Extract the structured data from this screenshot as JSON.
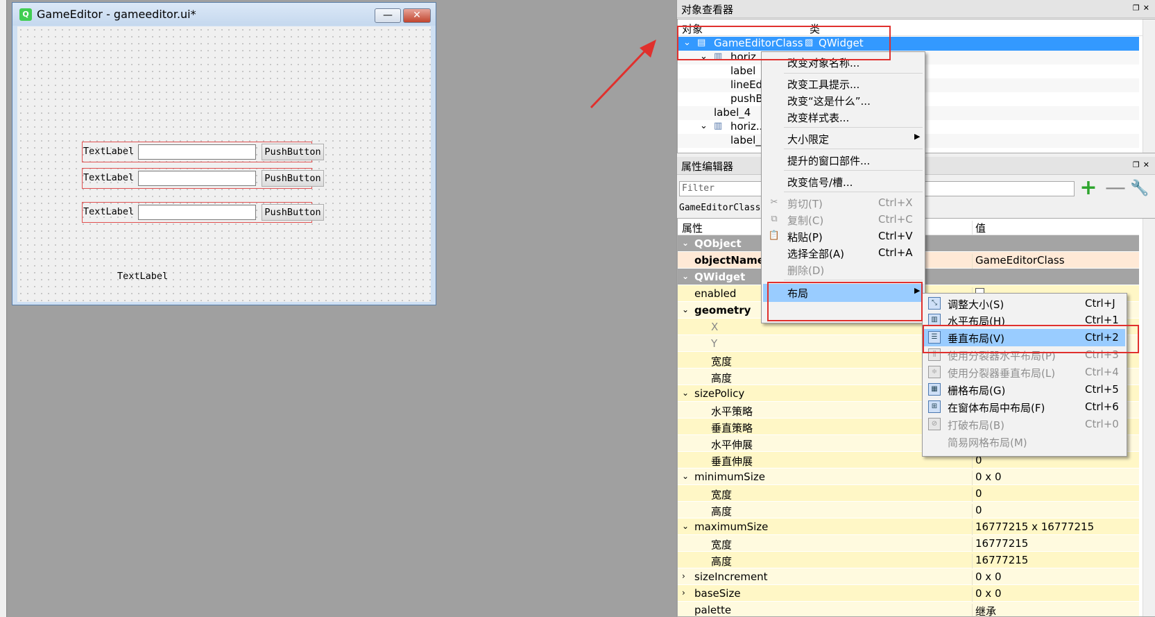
{
  "form_window": {
    "title": "GameEditor - gameeditor.ui*",
    "logo": "Q",
    "rows": [
      {
        "label": "TextLabel",
        "button": "PushButton"
      },
      {
        "label": "TextLabel",
        "button": "PushButton"
      },
      {
        "label": "TextLabel",
        "button": "PushButton"
      }
    ],
    "lone_label": "TextLabel"
  },
  "object_inspector": {
    "title": "对象查看器",
    "col_object": "对象",
    "col_class": "类",
    "rows": [
      {
        "name": "GameEditorClass",
        "class": "QWidget"
      },
      {
        "name": "horiz..."
      },
      {
        "name": "label"
      },
      {
        "name": "lineEd"
      },
      {
        "name": "pushB"
      },
      {
        "name": "label_4"
      },
      {
        "name": "horiz..."
      },
      {
        "name": "label_"
      }
    ]
  },
  "property_editor": {
    "title": "属性编辑器",
    "filter_placeholder": "Filter",
    "class_line": "GameEditorClass",
    "col_property": "属性",
    "col_value": "值",
    "rows": [
      {
        "name": "QObject",
        "value": ""
      },
      {
        "name": "objectName",
        "value": "GameEditorClass"
      },
      {
        "name": "QWidget",
        "value": ""
      },
      {
        "name": "enabled",
        "value": ""
      },
      {
        "name": "geometry",
        "value": ""
      },
      {
        "name": "X",
        "value": ""
      },
      {
        "name": "Y",
        "value": ""
      },
      {
        "name": "宽度",
        "value": ""
      },
      {
        "name": "高度",
        "value": ""
      },
      {
        "name": "sizePolicy",
        "value": ""
      },
      {
        "name": "水平策略",
        "value": ""
      },
      {
        "name": "垂直策略",
        "value": ""
      },
      {
        "name": "水平伸展",
        "value": ""
      },
      {
        "name": "垂直伸展",
        "value": "0"
      },
      {
        "name": "minimumSize",
        "value": "0 x 0"
      },
      {
        "name": "宽度",
        "value": "0"
      },
      {
        "name": "高度",
        "value": "0"
      },
      {
        "name": "maximumSize",
        "value": "16777215 x 16777215"
      },
      {
        "name": "宽度",
        "value": "16777215"
      },
      {
        "name": "高度",
        "value": "16777215"
      },
      {
        "name": "sizeIncrement",
        "value": "0 x 0"
      },
      {
        "name": "baseSize",
        "value": "0 x 0"
      },
      {
        "name": "palette",
        "value": "继承"
      }
    ]
  },
  "context_menu": {
    "items": [
      {
        "label": "改变对象名称..."
      },
      {
        "label": "改变工具提示..."
      },
      {
        "label": "改变“这是什么”..."
      },
      {
        "label": "改变样式表..."
      },
      {
        "label": "大小限定"
      },
      {
        "label": "提升的窗口部件..."
      },
      {
        "label": "改变信号/槽..."
      },
      {
        "label": "剪切(T)",
        "shortcut": "Ctrl+X"
      },
      {
        "label": "复制(C)",
        "shortcut": "Ctrl+C"
      },
      {
        "label": "粘贴(P)",
        "shortcut": "Ctrl+V"
      },
      {
        "label": "选择全部(A)",
        "shortcut": "Ctrl+A"
      },
      {
        "label": "删除(D)"
      },
      {
        "label": "布局"
      }
    ]
  },
  "layout_submenu": {
    "items": [
      {
        "label": "调整大小(S)",
        "shortcut": "Ctrl+J"
      },
      {
        "label": "水平布局(H)",
        "shortcut": "Ctrl+1"
      },
      {
        "label": "垂直布局(V)",
        "shortcut": "Ctrl+2"
      },
      {
        "label": "使用分裂器水平布局(P)",
        "shortcut": "Ctrl+3"
      },
      {
        "label": "使用分裂器垂直布局(L)",
        "shortcut": "Ctrl+4"
      },
      {
        "label": "栅格布局(G)",
        "shortcut": "Ctrl+5"
      },
      {
        "label": "在窗体布局中布局(F)",
        "shortcut": "Ctrl+6"
      },
      {
        "label": "打破布局(B)",
        "shortcut": "Ctrl+0"
      },
      {
        "label": "简易网格布局(M)"
      }
    ]
  },
  "colors": {
    "selection": "#3399ff",
    "menu_highlight": "#99ccff",
    "annotation_red": "#e0302d",
    "property_group": "#a4a4a4",
    "property_row": "#fff7c6"
  }
}
